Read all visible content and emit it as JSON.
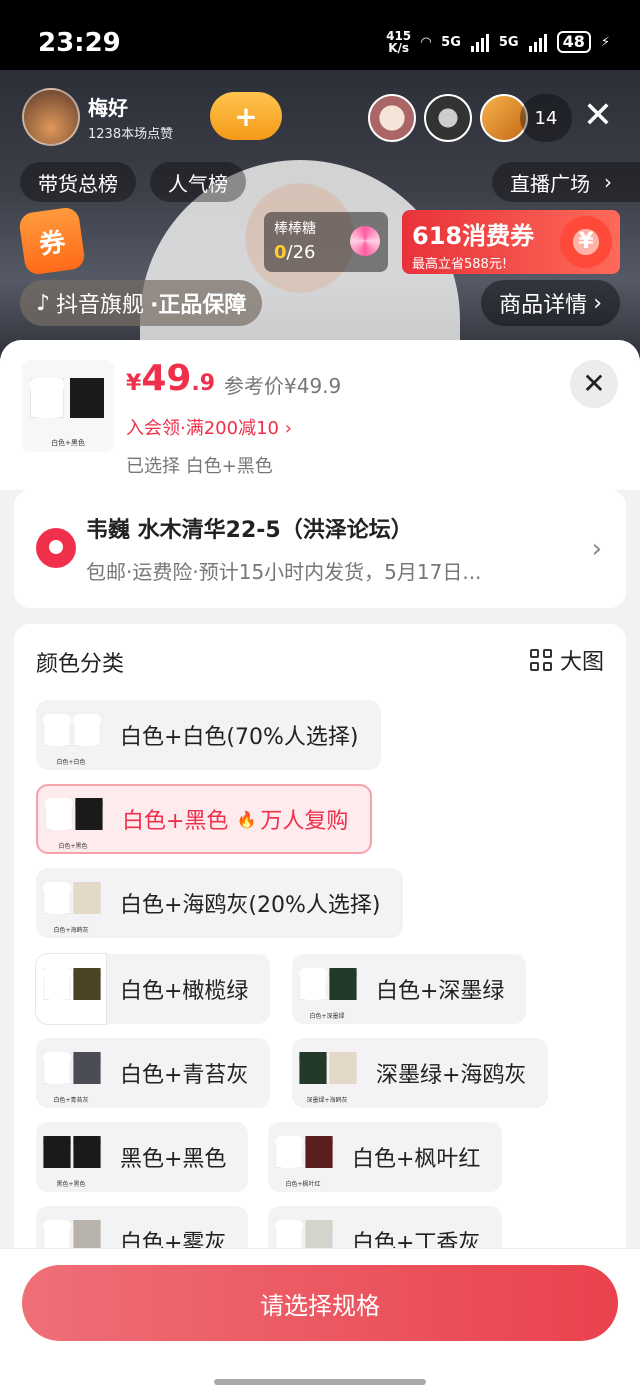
{
  "status_bar": {
    "time": "23:29",
    "net_speed_value": "415",
    "net_speed_unit": "K/s",
    "network": "5G",
    "battery": "48"
  },
  "live": {
    "host_name": "梅好",
    "host_likes": "1238本场点赞",
    "follow_icon": "plus-heart",
    "viewer_count": "14",
    "rank_sales": "带货总榜",
    "rank_popularity": "人气榜",
    "plaza": "直播广场",
    "coupon_badge": "券",
    "candy_title": "棒棒糖",
    "candy_progress_current": "0",
    "candy_progress_total": "/26",
    "coupon618_title": "618消费券",
    "coupon618_sub": "最高立省588元!",
    "brand_label": "抖音旗舰",
    "brand_guarantee": "·正品保障",
    "product_detail": "商品详情"
  },
  "product": {
    "thumb_label": "白色+黑色",
    "price_symbol": "¥",
    "price_int": "49",
    "price_dec": ".9",
    "reference_price": "参考价¥49.9",
    "member_offer": "入会领·满200减10",
    "selected": "已选择 白色+黑色"
  },
  "address": {
    "line1": "韦巍  水木清华22-5（洪泽论坛）",
    "line2": "包邮·运费险·预计15小时内发货，5月17日..."
  },
  "spec": {
    "title": "颜色分类",
    "big_view": "大图",
    "options": [
      {
        "label": "白色+白色(70%人选择)",
        "thumb": "白色+白色"
      },
      {
        "label": "白色+黑色",
        "badge": "万人复购",
        "thumb": "白色+黑色",
        "selected": true
      },
      {
        "label": "白色+海鸥灰(20%人选择)",
        "thumb": "白色+海鸥灰"
      },
      {
        "label": "白色+橄榄绿",
        "thumb": ""
      },
      {
        "label": "白色+深墨绿",
        "thumb": "白色+深墨绿"
      },
      {
        "label": "白色+青苔灰",
        "thumb": "白色+青苔灰"
      },
      {
        "label": "深墨绿+海鸥灰",
        "thumb": "深墨绿+海鸥灰"
      },
      {
        "label": "黑色+黑色",
        "thumb": "黑色+黑色"
      },
      {
        "label": "白色+枫叶红",
        "thumb": "白色+枫叶红"
      },
      {
        "label": "白色+雾灰",
        "thumb": ""
      },
      {
        "label": "白色+丁香灰",
        "thumb": ""
      }
    ]
  },
  "footer": {
    "cta": "请选择规格"
  },
  "colors": {
    "accent": "#f0304a",
    "cta_start": "#ef6f77",
    "cta_end": "#e9424d"
  }
}
